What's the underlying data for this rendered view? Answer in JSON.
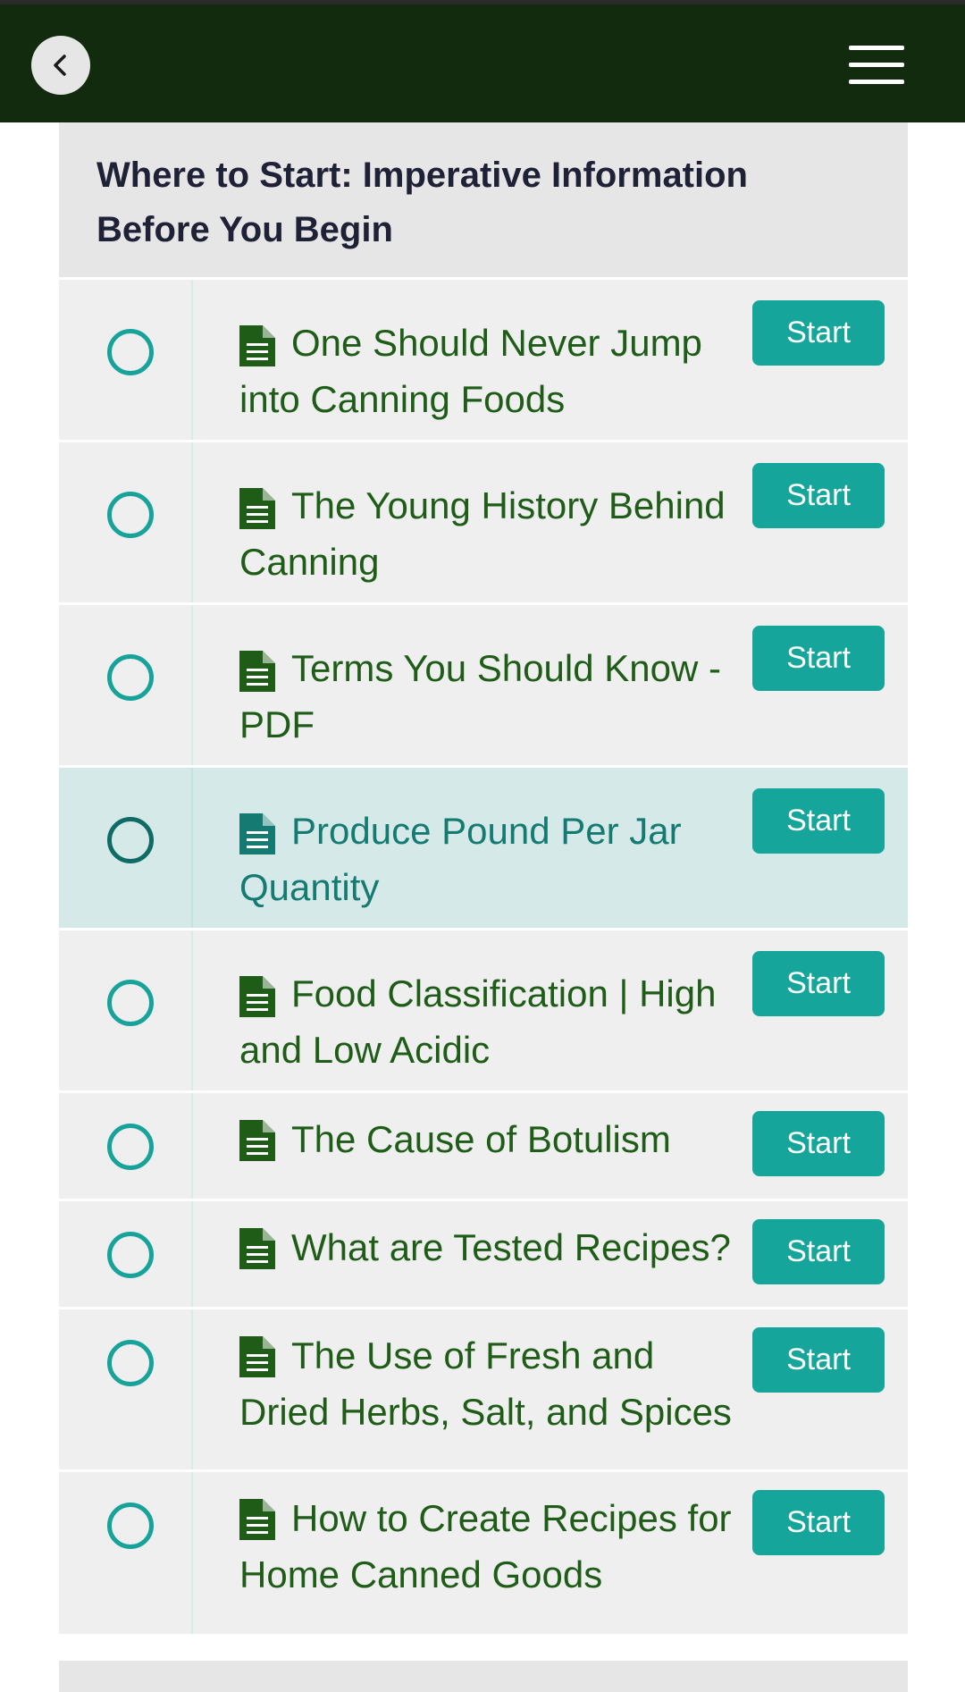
{
  "header": {
    "back_label": "Back",
    "menu_label": "Menu",
    "background_color": "#122a0e"
  },
  "section": {
    "title": "Where to Start: Imperative Information Before You Begin"
  },
  "lessons": [
    {
      "title": "One Should Never Jump into Canning Foods",
      "button_label": "Start",
      "completed": false,
      "active": false
    },
    {
      "title": "The Young History Behind Canning",
      "button_label": "Start",
      "completed": false,
      "active": false
    },
    {
      "title": "Terms You Should Know - PDF",
      "button_label": "Start",
      "completed": false,
      "active": false
    },
    {
      "title": "Produce Pound Per Jar Quantity",
      "button_label": "Start",
      "completed": false,
      "active": true
    },
    {
      "title": "Food Classification | High and Low Acidic",
      "button_label": "Start",
      "completed": false,
      "active": false
    },
    {
      "title": "The Cause of Botulism",
      "button_label": "Start",
      "completed": false,
      "active": false
    },
    {
      "title": "What are Tested Recipes?",
      "button_label": "Start",
      "completed": false,
      "active": false
    },
    {
      "title": "The Use of Fresh and Dried Herbs, Salt, and Spices",
      "button_label": "Start",
      "completed": false,
      "active": false
    },
    {
      "title": "How to Create Recipes for Home Canned Goods",
      "button_label": "Start",
      "completed": false,
      "active": false
    }
  ],
  "colors": {
    "accent": "#15a59a",
    "lesson_text": "#1f5c18",
    "active_row": "#d5eae8"
  }
}
